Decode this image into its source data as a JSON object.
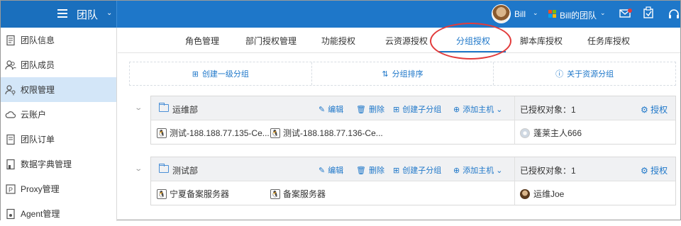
{
  "header": {
    "title": "团队",
    "user_name": "Bill",
    "org_name": "Bill的团队"
  },
  "sidebar": {
    "items": [
      {
        "label": "团队信息",
        "icon": "document-icon"
      },
      {
        "label": "团队成员",
        "icon": "users-icon"
      },
      {
        "label": "权限管理",
        "icon": "user-key-icon",
        "active": true
      },
      {
        "label": "云账户",
        "icon": "cloud-icon"
      },
      {
        "label": "团队订单",
        "icon": "receipt-icon"
      },
      {
        "label": "数据字典管理",
        "icon": "book-icon"
      },
      {
        "label": "Proxy管理",
        "icon": "proxy-icon"
      },
      {
        "label": "Agent管理",
        "icon": "agent-icon"
      }
    ]
  },
  "tabs": [
    {
      "label": "角色管理"
    },
    {
      "label": "部门授权管理"
    },
    {
      "label": "功能授权"
    },
    {
      "label": "云资源授权"
    },
    {
      "label": "分组授权",
      "active": true
    },
    {
      "label": "脚本库授权"
    },
    {
      "label": "任务库授权"
    }
  ],
  "actions": {
    "create": "创建一级分组",
    "sort": "分组排序",
    "about": "关于资源分组"
  },
  "group_actions": {
    "edit": "编辑",
    "delete": "删除",
    "create_child": "创建子分组",
    "add_host": "添加主机",
    "authorize": "授权"
  },
  "groups": [
    {
      "name": "运维部",
      "auth_count": "已授权对象：1",
      "hosts": [
        "测试-188.188.77.135-Ce...",
        "测试-188.188.77.136-Ce..."
      ],
      "member": "蓬莱主人666"
    },
    {
      "name": "测试部",
      "auth_count": "已授权对象：1",
      "hosts": [
        "宁夏备案服务器",
        "备案服务器"
      ],
      "member": "运维Joe"
    }
  ],
  "colors": {
    "primary": "#1e77c9",
    "highlight_circle": "#e23b3b",
    "active_sidebar": "#d3e6f8"
  }
}
